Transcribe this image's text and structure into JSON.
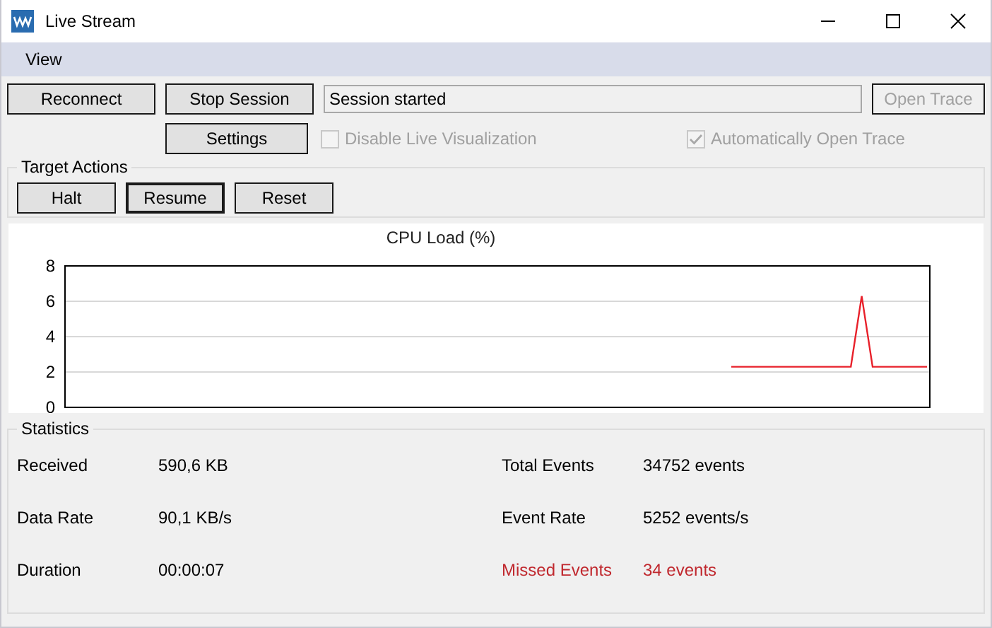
{
  "window": {
    "title": "Live Stream"
  },
  "menu": [
    {
      "label": "View"
    }
  ],
  "toolbar": {
    "buttons": [
      {
        "label": "Reconnect",
        "disabled": false
      },
      {
        "label": "Stop Session",
        "disabled": false
      }
    ],
    "status": "Session started",
    "open_trace": {
      "label": "Open Trace",
      "disabled": true
    },
    "settings": {
      "label": "Settings",
      "disabled": false
    },
    "checkboxes": [
      {
        "label": "Disable Live Visualization",
        "checked": false,
        "disabled": true
      },
      {
        "label": "Automatically Open Trace",
        "checked": true,
        "disabled": true
      }
    ]
  },
  "target_actions": {
    "title": "Target Actions",
    "buttons": [
      {
        "label": "Halt",
        "default": false
      },
      {
        "label": "Resume",
        "default": true
      },
      {
        "label": "Reset",
        "default": false
      }
    ]
  },
  "chart": {
    "chart_data": {
      "type": "line",
      "title": "CPU Load (%)",
      "ylim": [
        0,
        8
      ],
      "grid": true,
      "yticks": [
        0,
        2,
        4,
        6,
        8
      ],
      "values": [
        null,
        null,
        null,
        null,
        null,
        null,
        null,
        null,
        null,
        null,
        null,
        null,
        null,
        null,
        null,
        null,
        null,
        null,
        null,
        null,
        null,
        null,
        null,
        null,
        null,
        null,
        null,
        null,
        null,
        null,
        null,
        null,
        null,
        null,
        null,
        null,
        null,
        null,
        null,
        null,
        null,
        null,
        null,
        null,
        null,
        null,
        null,
        null,
        null,
        null,
        null,
        null,
        null,
        null,
        null,
        null,
        null,
        null,
        null,
        null,
        null,
        2.3,
        2.3,
        2.3,
        2.3,
        2.3,
        2.3,
        2.3,
        2.3,
        2.3,
        2.3,
        2.3,
        2.3,
        6.3,
        2.3,
        2.3,
        2.3,
        2.3,
        2.3,
        2.3
      ]
    }
  },
  "statistics": {
    "title": "Statistics",
    "items": [
      {
        "label": "Received",
        "value": "590,6 KB",
        "alert": false
      },
      {
        "label": "Total Events",
        "value": "34752 events",
        "alert": false
      },
      {
        "label": "Data Rate",
        "value": "90,1 KB/s",
        "alert": false
      },
      {
        "label": "Event Rate",
        "value": "5252 events/s",
        "alert": false
      },
      {
        "label": "Duration",
        "value": "00:00:07",
        "alert": false
      },
      {
        "label": "Missed Events",
        "value": "34 events",
        "alert": true
      }
    ]
  }
}
